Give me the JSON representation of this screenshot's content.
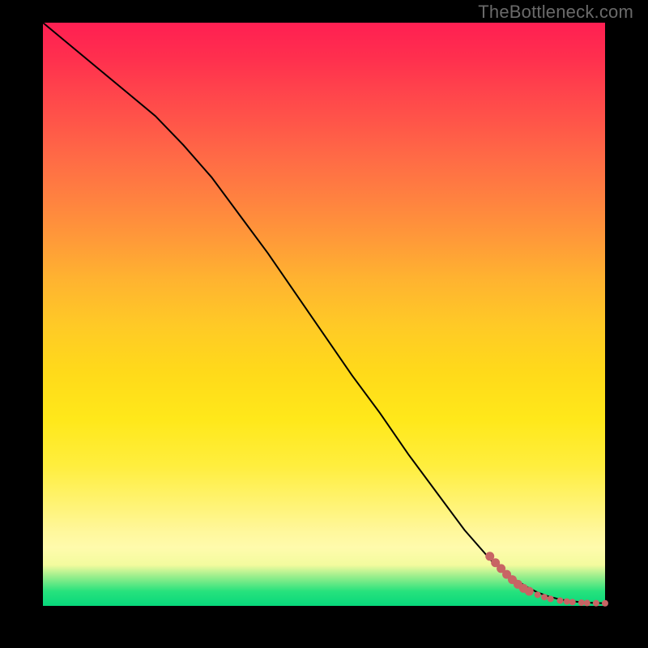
{
  "watermark": "TheBottleneck.com",
  "colors": {
    "frame_bg": "#000000",
    "watermark_text": "#6a6a6a",
    "curve_stroke": "#000000",
    "marker_fill": "#c86464",
    "marker_stroke": "#c86464"
  },
  "chart_data": {
    "type": "line",
    "title": "",
    "xlabel": "",
    "ylabel": "",
    "xlim": [
      0,
      100
    ],
    "ylim": [
      0,
      100
    ],
    "grid": false,
    "legend": false,
    "background": "vertical heat gradient from green (bottom) through yellow (middle) to red (top), framed by black border",
    "series": [
      {
        "name": "bottleneck-curve",
        "x": [
          0,
          10,
          15,
          20,
          25,
          30,
          35,
          40,
          45,
          50,
          55,
          60,
          65,
          70,
          75,
          80,
          82,
          84,
          86,
          88,
          90,
          92,
          94,
          96,
          98,
          100
        ],
        "y": [
          100,
          92,
          88,
          84,
          79,
          73.5,
          67,
          60.5,
          53.5,
          46.5,
          39.5,
          33,
          26,
          19.5,
          13,
          7.5,
          6,
          4.5,
          3.3,
          2.3,
          1.6,
          1.1,
          0.8,
          0.6,
          0.5,
          0.45
        ],
        "stroke": "#000000",
        "stroke_width": 2
      }
    ],
    "markers": {
      "name": "flat-region-markers",
      "color": "#c86464",
      "radius_large": 5.5,
      "radius_small": 4,
      "points": [
        {
          "x": 79.5,
          "y": 8.5,
          "r": 5.5
        },
        {
          "x": 80.5,
          "y": 7.4,
          "r": 5.5
        },
        {
          "x": 81.5,
          "y": 6.4,
          "r": 5.5
        },
        {
          "x": 82.5,
          "y": 5.4,
          "r": 5.5
        },
        {
          "x": 83.5,
          "y": 4.5,
          "r": 5.5
        },
        {
          "x": 84.5,
          "y": 3.7,
          "r": 5.5
        },
        {
          "x": 85.5,
          "y": 3.0,
          "r": 5.5
        },
        {
          "x": 86.5,
          "y": 2.5,
          "r": 5.5
        },
        {
          "x": 88.0,
          "y": 1.9,
          "r": 4
        },
        {
          "x": 89.2,
          "y": 1.5,
          "r": 4
        },
        {
          "x": 90.3,
          "y": 1.2,
          "r": 4
        },
        {
          "x": 92.0,
          "y": 0.9,
          "r": 4
        },
        {
          "x": 93.2,
          "y": 0.75,
          "r": 4
        },
        {
          "x": 94.2,
          "y": 0.65,
          "r": 4
        },
        {
          "x": 95.8,
          "y": 0.55,
          "r": 4
        },
        {
          "x": 96.8,
          "y": 0.5,
          "r": 4
        },
        {
          "x": 98.4,
          "y": 0.47,
          "r": 4
        },
        {
          "x": 100.0,
          "y": 0.45,
          "r": 4
        }
      ]
    }
  }
}
